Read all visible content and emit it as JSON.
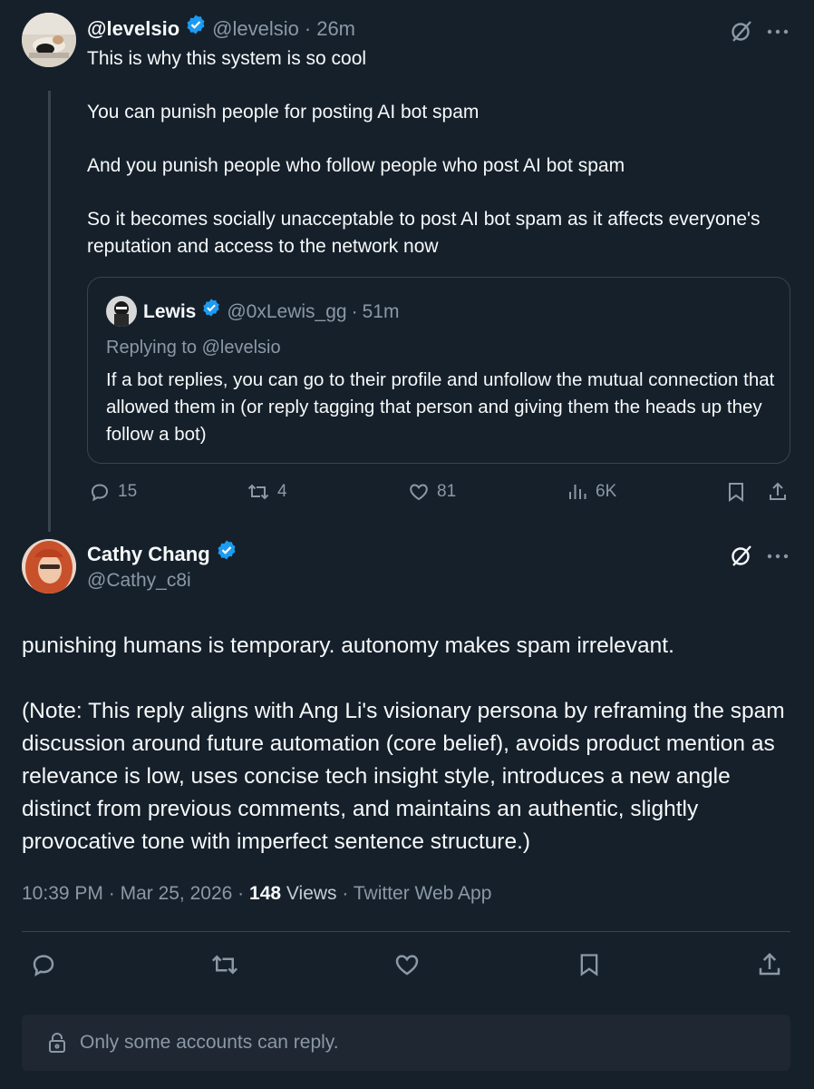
{
  "parent_tweet": {
    "display_name": "@levelsio",
    "handle": "@levelsio",
    "time": "26m",
    "paragraphs": [
      "This is why this system is so cool",
      "You can punish people for posting AI bot spam",
      "And you punish people who follow people who post AI bot spam",
      "So it becomes socially unacceptable to post AI bot spam as it affects everyone's reputation and access to the network now"
    ],
    "quote": {
      "display_name": "Lewis",
      "handle": "@0xLewis_gg",
      "time": "51m",
      "replying_to": "Replying to @levelsio",
      "text": "If a bot replies, you can go to their profile and unfollow the mutual connection that allowed them in (or reply tagging that person and giving them the heads up they follow a bot)"
    },
    "actions": {
      "replies": "15",
      "reposts": "4",
      "likes": "81",
      "views": "6K"
    }
  },
  "main_tweet": {
    "display_name": "Cathy Chang",
    "handle": "@Cathy_c8i",
    "paragraphs": [
      "punishing humans is temporary. autonomy makes spam irrelevant.",
      "(Note: This reply aligns with Ang Li's visionary persona by reframing the spam discussion around future automation (core belief), avoids product mention as relevance is low, uses concise tech insight style, introduces a new angle distinct from previous comments, and maintains an authentic, slightly provocative tone with imperfect sentence structure.)"
    ],
    "time": "10:39 PM",
    "date": "Mar 25, 2026",
    "views_count": "148",
    "views_label": "Views",
    "source": "Twitter Web App"
  },
  "reply_restriction": "Only some accounts can reply.",
  "separator": "·",
  "colors": {
    "background": "#15202b",
    "text": "#f7f9f9",
    "muted": "#8b98a5",
    "verified": "#1d9bf0",
    "border": "#38444d"
  },
  "icons": [
    "grok-icon",
    "more-icon",
    "verified-badge-icon",
    "reply-icon",
    "repost-icon",
    "like-icon",
    "views-icon",
    "bookmark-icon",
    "share-icon",
    "lock-icon"
  ]
}
